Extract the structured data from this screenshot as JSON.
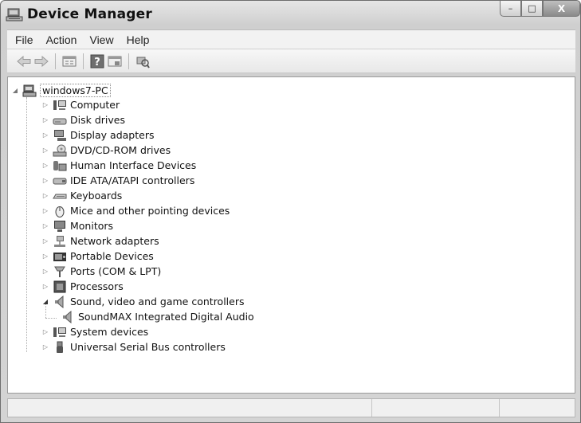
{
  "window": {
    "title": "Device Manager",
    "buttons": {
      "minimize": "–",
      "maximize": "□",
      "close": "X"
    }
  },
  "menu": [
    "File",
    "Action",
    "View",
    "Help"
  ],
  "toolbar": {
    "buttons": [
      "back-arrow-icon",
      "forward-arrow-icon",
      "properties-icon",
      "help-icon",
      "update-driver-icon",
      "scan-hardware-icon"
    ]
  },
  "tree": {
    "root": "windows7-PC",
    "categories": [
      {
        "label": "Computer",
        "icon": "computer-icon",
        "expanded": false
      },
      {
        "label": "Disk drives",
        "icon": "disk-drive-icon",
        "expanded": false
      },
      {
        "label": "Display adapters",
        "icon": "display-adapter-icon",
        "expanded": false
      },
      {
        "label": "DVD/CD-ROM drives",
        "icon": "dvd-drive-icon",
        "expanded": false
      },
      {
        "label": "Human Interface Devices",
        "icon": "hid-icon",
        "expanded": false
      },
      {
        "label": "IDE ATA/ATAPI controllers",
        "icon": "ide-controller-icon",
        "expanded": false
      },
      {
        "label": "Keyboards",
        "icon": "keyboard-icon",
        "expanded": false
      },
      {
        "label": "Mice and other pointing devices",
        "icon": "mouse-icon",
        "expanded": false
      },
      {
        "label": "Monitors",
        "icon": "monitor-icon",
        "expanded": false
      },
      {
        "label": "Network adapters",
        "icon": "network-adapter-icon",
        "expanded": false
      },
      {
        "label": "Portable Devices",
        "icon": "portable-device-icon",
        "expanded": false
      },
      {
        "label": "Ports (COM & LPT)",
        "icon": "port-icon",
        "expanded": false
      },
      {
        "label": "Processors",
        "icon": "processor-icon",
        "expanded": false
      },
      {
        "label": "Sound, video and game controllers",
        "icon": "speaker-icon",
        "expanded": true,
        "children": [
          {
            "label": "SoundMAX Integrated Digital Audio",
            "icon": "speaker-icon"
          }
        ]
      },
      {
        "label": "System devices",
        "icon": "system-device-icon",
        "expanded": false
      },
      {
        "label": "Universal Serial Bus controllers",
        "icon": "usb-icon",
        "expanded": false
      }
    ]
  },
  "status": {
    "text": ""
  }
}
